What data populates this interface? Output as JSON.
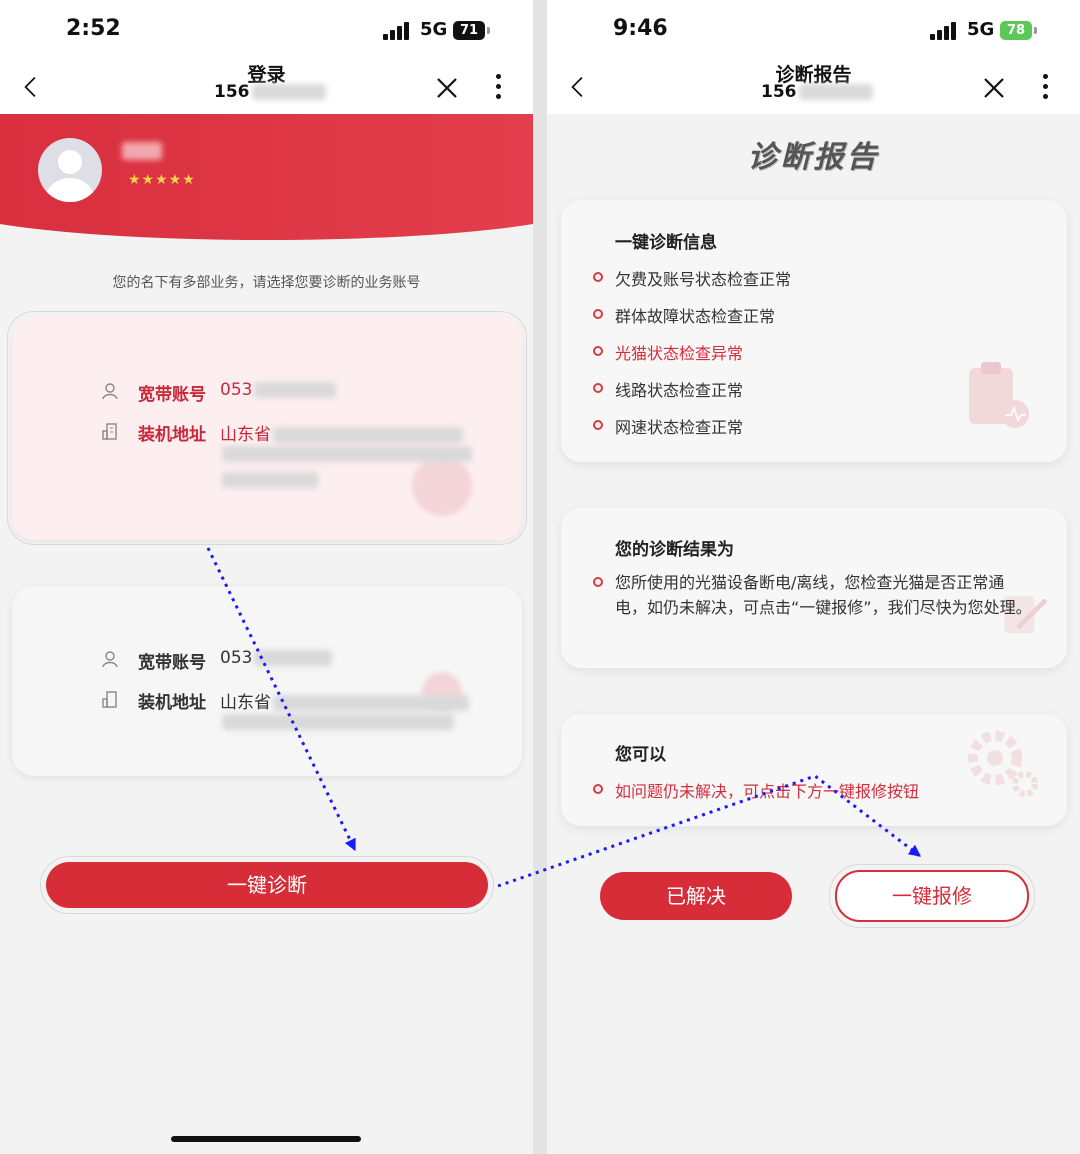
{
  "left_screen": {
    "status": {
      "time": "2:52",
      "network": "5G",
      "battery": "71"
    },
    "nav": {
      "title": "登录",
      "subtitle_prefix": "156"
    },
    "profile": {
      "stars": "★★★★★"
    },
    "hint": "您的名下有多部业务，请选择您要诊断的业务账号",
    "accounts": [
      {
        "account_label": "宽带账号",
        "account_value": "053",
        "address_label": "装机地址",
        "address_value": "山东省",
        "selected": true
      },
      {
        "account_label": "宽带账号",
        "account_value": "053",
        "address_label": "装机地址",
        "address_value": "山东省",
        "selected": false
      }
    ],
    "diagnose_button": "一键诊断"
  },
  "right_screen": {
    "status": {
      "time": "9:46",
      "network": "5G",
      "battery": "78"
    },
    "nav": {
      "title": "诊断报告",
      "subtitle_prefix": "156"
    },
    "report_title": "诊断报告",
    "info_card": {
      "title": "一键诊断信息",
      "items": [
        {
          "text": "欠费及账号状态检查正常",
          "status": "normal"
        },
        {
          "text": "群体故障状态检查正常",
          "status": "normal"
        },
        {
          "text": "光猫状态检查异常",
          "status": "abnormal"
        },
        {
          "text": "线路状态检查正常",
          "status": "normal"
        },
        {
          "text": "网速状态检查正常",
          "status": "normal"
        }
      ]
    },
    "result_card": {
      "title": "您的诊断结果为",
      "text": "您所使用的光猫设备断电/离线，您检查光猫是否正常通电，如仍未解决，可点击“一键报修”，我们尽快为您处理。"
    },
    "action_card": {
      "title": "您可以",
      "text": "如问题仍未解决，可点击下方一键报修按钮"
    },
    "solved_button": "已解决",
    "repair_button": "一键报修"
  },
  "colors": {
    "brand_red": "#d62d39",
    "annotation_arrow": "#1a1aff"
  }
}
